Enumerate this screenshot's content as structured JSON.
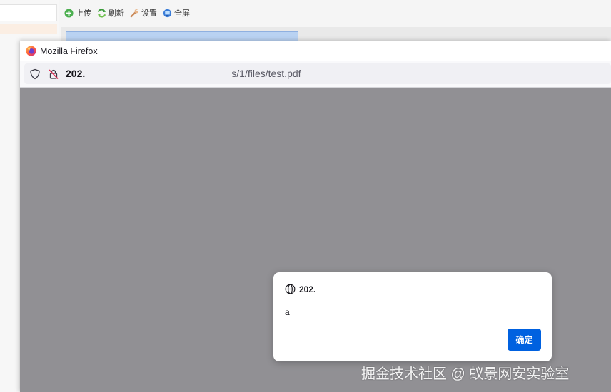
{
  "background_app": {
    "toolbar": {
      "upload_label": "上传",
      "refresh_label": "刷新",
      "settings_label": "设置",
      "fullscreen_label": "全屏"
    }
  },
  "firefox": {
    "window_title": "Mozilla Firefox",
    "url": {
      "host": "20",
      "host_tail": "2.",
      "path": "s/1/files/test.pdf"
    },
    "dialog": {
      "origin": "202.",
      "message": "a",
      "ok_label": "确定"
    }
  },
  "watermark": "掘金技术社区 @ 蚁景网安实验室",
  "colors": {
    "viewer_bg": "#919094",
    "ok_button": "#0061e0",
    "selected_strip": "#b9d2f2"
  }
}
